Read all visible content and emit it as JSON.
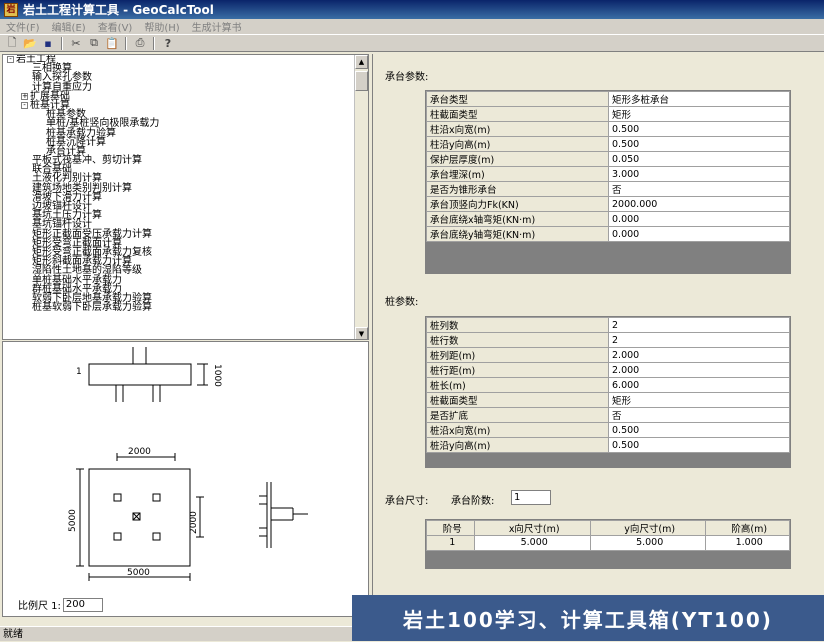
{
  "window": {
    "title": "岩土工程计算工具 - GeoCalcTool",
    "icon": "app-icon"
  },
  "menu": [
    "文件(F)",
    "编辑(E)",
    "查看(V)",
    "帮助(H)",
    "生成计算书"
  ],
  "toolbar": {
    "icons": [
      "new-file-icon",
      "open-folder-icon",
      "save-icon",
      "cut-icon",
      "copy-icon",
      "paste-icon",
      "print-icon",
      "help-icon"
    ]
  },
  "tree": {
    "items": [
      {
        "label": "岩土工程",
        "level": 0,
        "expander": "-"
      },
      {
        "label": "三相换算",
        "level": 1
      },
      {
        "label": "输入探孔参数",
        "level": 1
      },
      {
        "label": "计算自重应力",
        "level": 1
      },
      {
        "label": "扩展基础",
        "level": 1,
        "expander": "+"
      },
      {
        "label": "桩基计算",
        "level": 1,
        "expander": "-"
      },
      {
        "label": "桩基参数",
        "level": 2
      },
      {
        "label": "单桩/基桩竖向极限承载力",
        "level": 2
      },
      {
        "label": "桩基承载力验算",
        "level": 2
      },
      {
        "label": "桩基沉降计算",
        "level": 2
      },
      {
        "label": "承台计算",
        "level": 2
      },
      {
        "label": "平板式筏基冲、剪切计算",
        "level": 1
      },
      {
        "label": "联合基础",
        "level": 1
      },
      {
        "label": "土液化判别计算",
        "level": 1
      },
      {
        "label": "建筑场地类别判别计算",
        "level": 1
      },
      {
        "label": "滑坡下滑力计算",
        "level": 1
      },
      {
        "label": "边坡锚杆设计",
        "level": 1
      },
      {
        "label": "基坑土压力计算",
        "level": 1
      },
      {
        "label": "基坑锚杆设计",
        "level": 1
      },
      {
        "label": "矩形正截面受压承载力计算",
        "level": 1
      },
      {
        "label": "矩形受弯正截面计算",
        "level": 1
      },
      {
        "label": "矩形受弯正截面承载力复核",
        "level": 1
      },
      {
        "label": "矩形斜截面承载力计算",
        "level": 1
      },
      {
        "label": "湿陷性土地基的湿陷等级",
        "level": 1
      },
      {
        "label": "单桩基础水平承载力",
        "level": 1
      },
      {
        "label": "群桩基础水平承载力",
        "level": 1
      },
      {
        "label": "软弱下卧层地基承载力验算",
        "level": 1
      },
      {
        "label": "桩基软弱下卧层承载力验算",
        "level": 1
      }
    ]
  },
  "drawing": {
    "elev_label": "1",
    "elev_height": "1000",
    "top_width": "2000",
    "plan_height_outer": "5000",
    "plan_height_inner": "2000",
    "plan_width": "5000"
  },
  "scale": {
    "label": "比例尺 1:",
    "value": "200"
  },
  "cap": {
    "label": "承台参数:",
    "rows": [
      {
        "k": "承台类型",
        "v": "矩形多桩承台"
      },
      {
        "k": "柱截面类型",
        "v": "矩形"
      },
      {
        "k": "柱沿x向宽(m)",
        "v": "0.500"
      },
      {
        "k": "柱沿y向高(m)",
        "v": "0.500"
      },
      {
        "k": "保护层厚度(m)",
        "v": "0.050"
      },
      {
        "k": "承台埋深(m)",
        "v": "3.000"
      },
      {
        "k": "是否为锥形承台",
        "v": "否"
      },
      {
        "k": "承台顶竖向力Fk(KN)",
        "v": "2000.000"
      },
      {
        "k": "承台底绕x轴弯矩(KN·m)",
        "v": "0.000"
      },
      {
        "k": "承台底绕y轴弯矩(KN·m)",
        "v": "0.000"
      }
    ]
  },
  "pile": {
    "label": "桩参数:",
    "rows": [
      {
        "k": "桩列数",
        "v": "2"
      },
      {
        "k": "桩行数",
        "v": "2"
      },
      {
        "k": "桩列距(m)",
        "v": "2.000"
      },
      {
        "k": "桩行距(m)",
        "v": "2.000"
      },
      {
        "k": "桩长(m)",
        "v": "6.000"
      },
      {
        "k": "桩截面类型",
        "v": "矩形"
      },
      {
        "k": "是否扩底",
        "v": "否"
      },
      {
        "k": "桩沿x向宽(m)",
        "v": "0.500"
      },
      {
        "k": "桩沿y向高(m)",
        "v": "0.500"
      }
    ]
  },
  "size": {
    "label": "承台尺寸:",
    "tier_label": "承台阶数:",
    "tier_value": "1",
    "headers": [
      "阶号",
      "x向尺寸(m)",
      "y向尺寸(m)",
      "阶高(m)"
    ],
    "rows": [
      [
        "1",
        "5.000",
        "5.000",
        "1.000"
      ]
    ]
  },
  "status": "就绪",
  "watermark": "岩土100学习、计算工具箱(YT100)"
}
